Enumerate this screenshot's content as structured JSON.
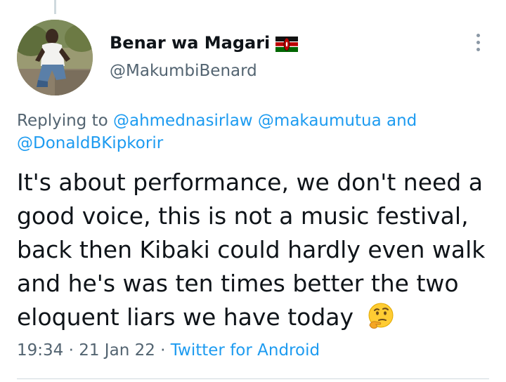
{
  "author": {
    "display_name": "Benar wa Magari",
    "flag_icon": "kenya-flag-icon",
    "handle": "@MakumbiBenard"
  },
  "reply_context": {
    "prefix": "Replying to",
    "mentions": [
      "@ahmednasirlaw",
      "@makaumutua",
      "@DonaldBKipkorir"
    ],
    "conjunction": "and"
  },
  "tweet": {
    "text": "It's about performance, we don't need a good voice, this is not a music festival, back then Kibaki could hardly even walk and he's was ten times better the two eloquent liars we have today",
    "emoji_icon": "thinking-face-icon"
  },
  "meta": {
    "time": "19:34",
    "date": "21 Jan 22",
    "separator": "·",
    "source": "Twitter for Android"
  },
  "colors": {
    "link": "#1d9bf0",
    "secondary_text": "#536471",
    "primary_text": "#0f1419"
  }
}
